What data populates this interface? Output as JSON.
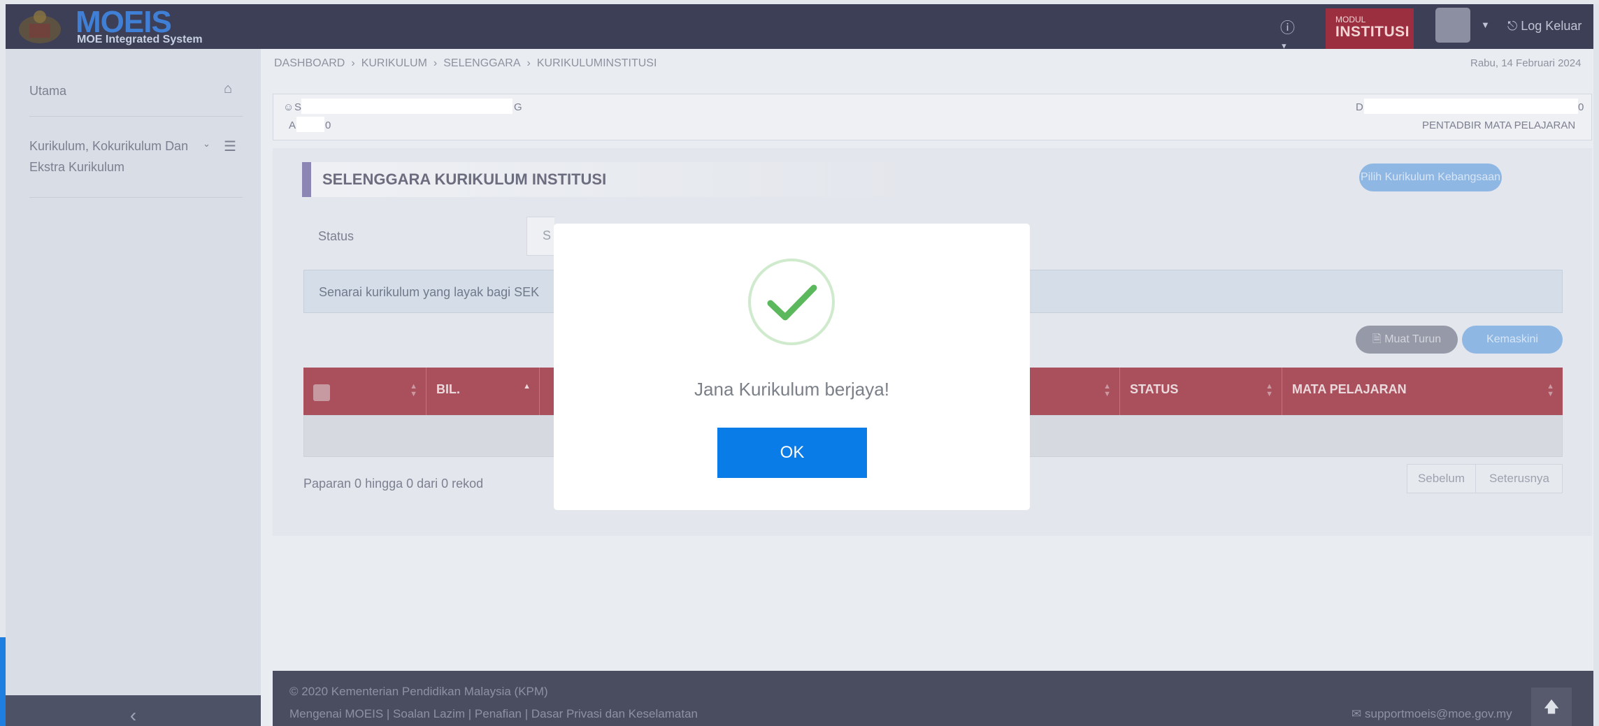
{
  "app": {
    "brand": "MOEIS",
    "subtitle": "MOE Integrated System"
  },
  "topbar": {
    "help_icon": "question-circle-icon",
    "modul_small": "MODUL",
    "modul_big": "INSTITUSI",
    "logout": "Log Keluar"
  },
  "sidebar": {
    "items": [
      {
        "label": "Utama",
        "icon": "home-icon"
      },
      {
        "label_line1": "Kurikulum, Kokurikulum Dan",
        "label_line2": "Ekstra Kurikulum",
        "icon": "list-icon"
      }
    ]
  },
  "breadcrumb": [
    "DASHBOARD",
    "KURIKULUM",
    "SELENGGARA",
    "KURIKULUMINSTITUSI"
  ],
  "date": "Rabu, 14 Februari 2024",
  "userbox": {
    "name_start": "S",
    "name_end": "G",
    "id_start": "A",
    "id_end": "0",
    "right_start": "D",
    "right_end": "0",
    "role": "PENTADBIR MATA PELAJARAN"
  },
  "section": {
    "title": "SELENGGARA KURIKULUM INSTITUSI",
    "pilih_button": "Pilih Kurikulum Kebangsaan",
    "status_label": "Status",
    "status_value": "S",
    "info": "Senarai kurikulum yang layak bagi SEK",
    "muat_turun": "Muat Turun",
    "kemaskini": "Kemaskini"
  },
  "table": {
    "headers": [
      "",
      "BIL.",
      "",
      "STATUS",
      "MATA PELAJARAN"
    ]
  },
  "paparan": "Paparan 0 hingga 0 dari 0 rekod",
  "pager": {
    "prev": "Sebelum",
    "next": "Seterusnya"
  },
  "footer": {
    "copyright": "© 2020 Kementerian Pendidikan Malaysia (KPM)",
    "links": "Mengenai MOEIS | Soalan Lazim | Penafian | Dasar Privasi dan Keselamatan",
    "email": "supportmoeis@moe.gov.my"
  },
  "modal": {
    "message": "Jana Kurikulum berjaya!",
    "ok": "OK",
    "icon": "success-check-icon"
  },
  "colors": {
    "ok_button": "#0a7ce8",
    "success_check": "#5cb85c",
    "table_header": "#a9505c"
  }
}
